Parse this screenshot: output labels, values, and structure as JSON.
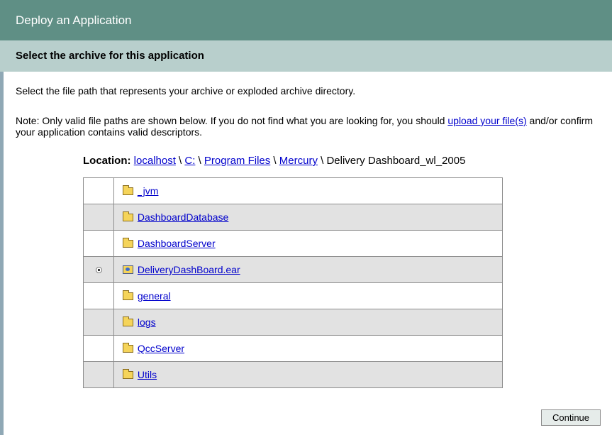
{
  "header": {
    "title": "Deploy an Application"
  },
  "subheader": {
    "title": "Select the archive for this application"
  },
  "main": {
    "intro": "Select the file path that represents your archive or exploded archive directory.",
    "note_before": "Note: Only valid file paths are shown below. If you do not find what you are looking for, you should ",
    "note_link": "upload your file(s)",
    "note_after": " and/or confirm your application contains valid descriptors."
  },
  "location": {
    "label": "Location:",
    "crumbs": [
      "localhost",
      "C:",
      "Program Files",
      "Mercury"
    ],
    "separator": " \\ ",
    "current": "Delivery Dashboard_wl_2005"
  },
  "files": [
    {
      "name": "_jvm",
      "icon": "folder-icon",
      "selected": false
    },
    {
      "name": "DashboardDatabase",
      "icon": "folder-icon",
      "selected": false
    },
    {
      "name": "DashboardServer",
      "icon": "folder-icon",
      "selected": false
    },
    {
      "name": "DeliveryDashBoard.ear",
      "icon": "archive-icon",
      "selected": true
    },
    {
      "name": "general",
      "icon": "folder-icon",
      "selected": false
    },
    {
      "name": "logs",
      "icon": "folder-icon",
      "selected": false
    },
    {
      "name": "QccServer",
      "icon": "folder-icon",
      "selected": false
    },
    {
      "name": "Utils",
      "icon": "folder-icon",
      "selected": false
    }
  ],
  "buttons": {
    "continue": "Continue"
  },
  "colors": {
    "header": "#5f8f85",
    "subheader": "#b8cfcc",
    "link": "#0000cc",
    "row_alt": "#e2e2e2"
  }
}
